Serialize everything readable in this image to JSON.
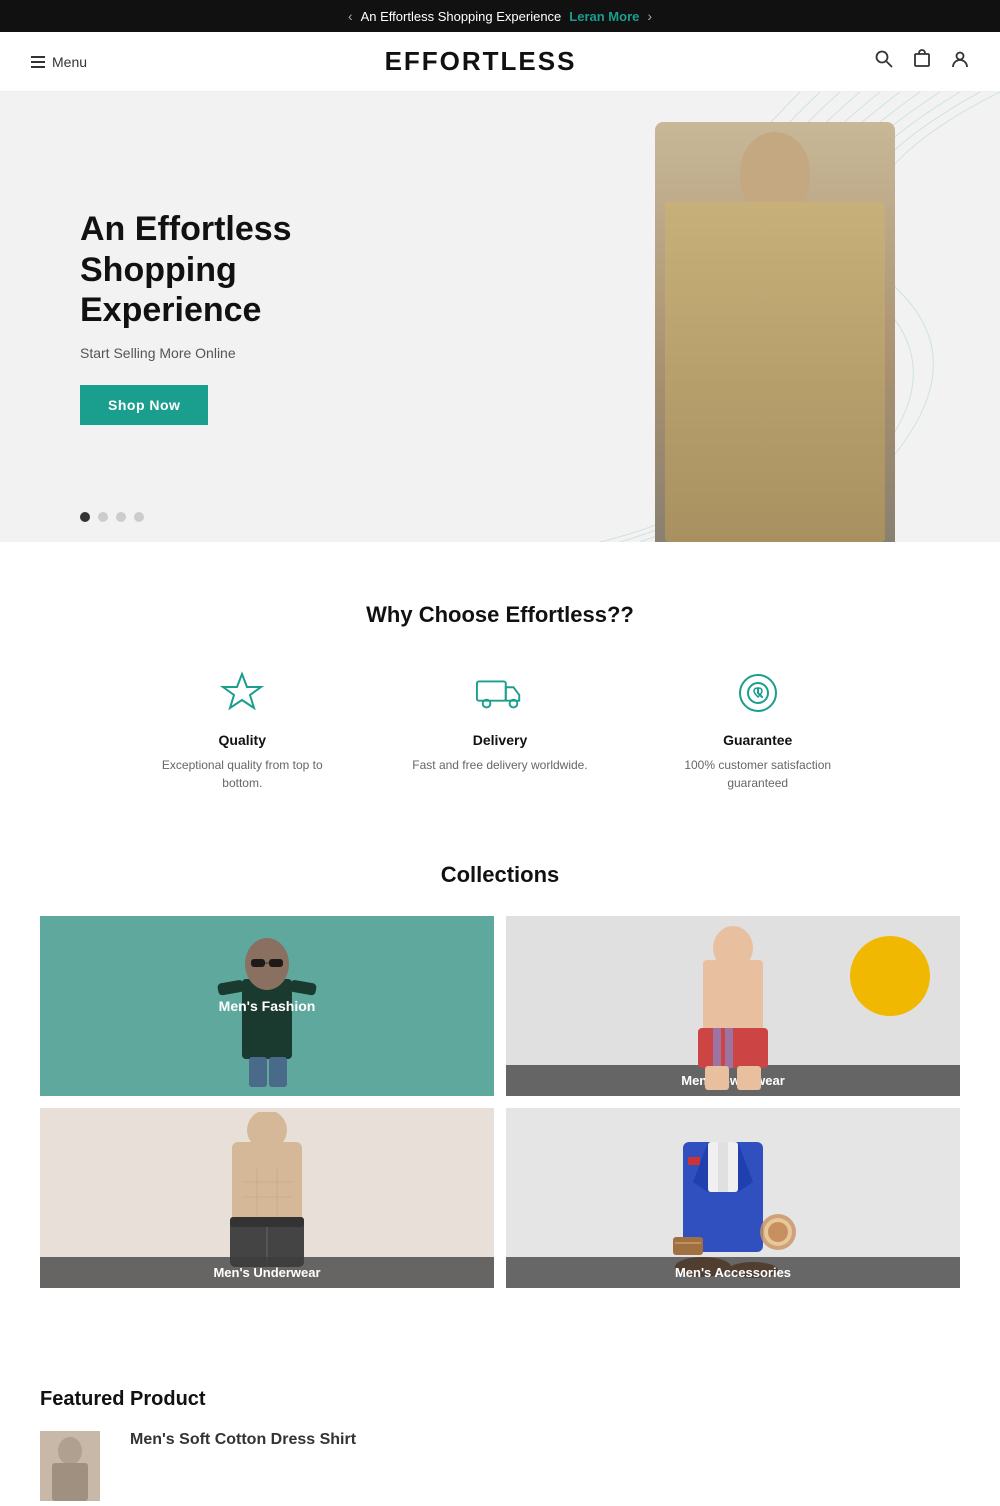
{
  "topBar": {
    "message": "An Effortless Shopping Experience",
    "learnMore": "Leran More",
    "prevIcon": "‹",
    "nextIcon": "›"
  },
  "header": {
    "menuLabel": "Menu",
    "logo": "EFFORTLESS",
    "searchIcon": "search",
    "cartIcon": "cart",
    "userIcon": "user"
  },
  "hero": {
    "headline": "An Effortless Shopping Experience",
    "subtext": "Start Selling More Online",
    "cta": "Shop Now",
    "dots": [
      true,
      false,
      false,
      false
    ]
  },
  "whyChoose": {
    "title": "Why Choose Effortless??",
    "features": [
      {
        "icon": "star",
        "title": "Quality",
        "description": "Exceptional quality from top to bottom."
      },
      {
        "icon": "delivery",
        "title": "Delivery",
        "description": "Fast and free delivery worldwide."
      },
      {
        "icon": "guarantee",
        "title": "Guarantee",
        "description": "100% customer satisfaction guaranteed"
      }
    ]
  },
  "collections": {
    "title": "Collections",
    "items": [
      {
        "label": "Men's Fashion",
        "type": "mens-fashion"
      },
      {
        "label": "Men's Swimwear",
        "type": "mens-swimwear"
      },
      {
        "label": "Men's Underwear",
        "type": "mens-underwear"
      },
      {
        "label": "Men's Accessories",
        "type": "mens-accessories"
      }
    ]
  },
  "featuredProduct": {
    "title": "Featured Product",
    "productName": "Men's Soft Cotton Dress Shirt"
  }
}
